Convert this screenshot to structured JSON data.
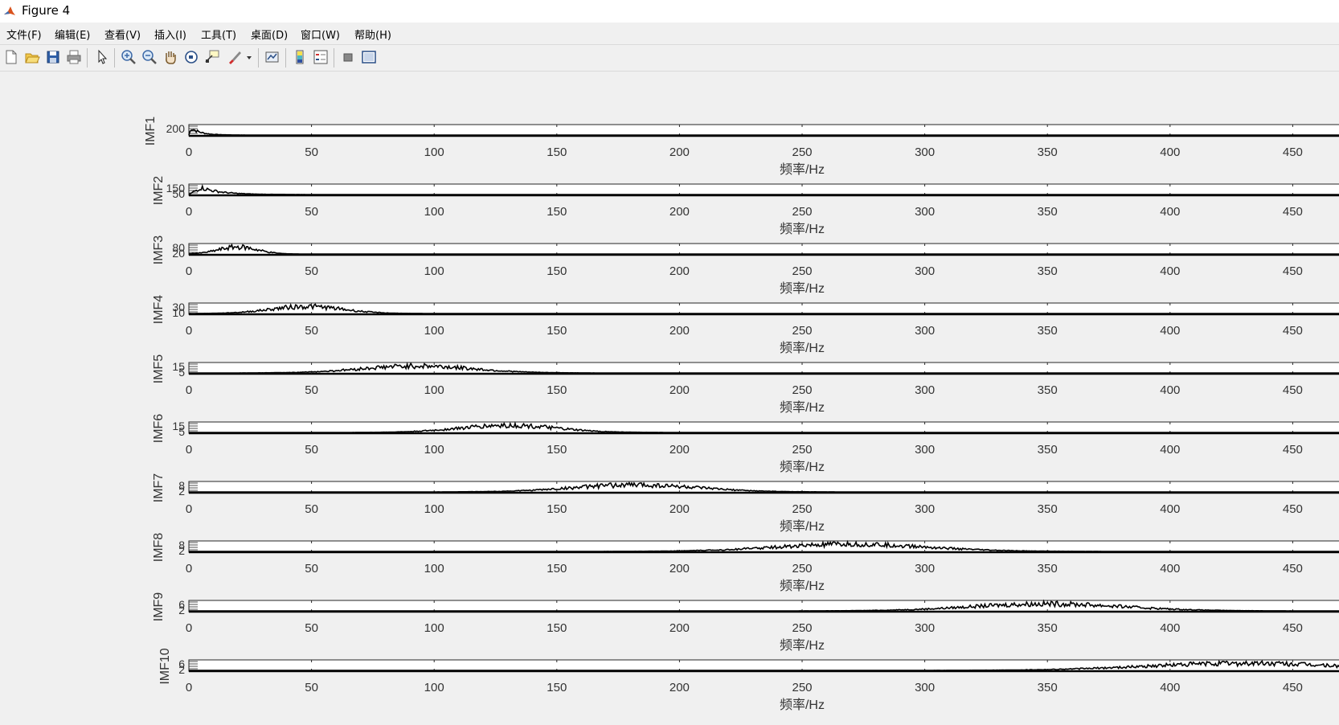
{
  "window": {
    "title": "Figure 4"
  },
  "menu": {
    "items": [
      "文件(F)",
      "编辑(E)",
      "查看(V)",
      "插入(I)",
      "工具(T)",
      "桌面(D)",
      "窗口(W)",
      "帮助(H)"
    ]
  },
  "toolbar": {
    "buttons": [
      "new-figure",
      "open-file",
      "save",
      "print",
      "select-pointer",
      "zoom-in",
      "zoom-out",
      "pan",
      "rotate-3d",
      "data-cursor",
      "brush",
      "link-plot",
      "insert-colorbar",
      "insert-legend",
      "hide-plot-tools",
      "show-plot-tools"
    ]
  },
  "chart_data": {
    "type": "line",
    "xlim": [
      0,
      500
    ],
    "x_ticks": [
      0,
      50,
      100,
      150,
      200,
      250,
      300,
      350,
      400,
      450
    ],
    "xlabel": "频率/Hz",
    "line_color": "#000000",
    "panels": [
      {
        "ylabel": "IMF1",
        "yticks": [
          "200"
        ],
        "peak_hz": 1,
        "width_hz": 4,
        "envelope": "decay"
      },
      {
        "ylabel": "IMF2",
        "yticks": [
          "150",
          "50"
        ],
        "peak_hz": 5,
        "width_hz": 8,
        "envelope": "decay"
      },
      {
        "ylabel": "IMF3",
        "yticks": [
          "80",
          "20"
        ],
        "peak_hz": 20,
        "width_hz": 14,
        "envelope": "bump"
      },
      {
        "ylabel": "IMF4",
        "yticks": [
          "30",
          "10"
        ],
        "peak_hz": 48,
        "width_hz": 26,
        "envelope": "bump"
      },
      {
        "ylabel": "IMF5",
        "yticks": [
          "15",
          "5"
        ],
        "peak_hz": 93,
        "width_hz": 40,
        "envelope": "bump"
      },
      {
        "ylabel": "IMF6",
        "yticks": [
          "15",
          "5"
        ],
        "peak_hz": 130,
        "width_hz": 35,
        "envelope": "bump"
      },
      {
        "ylabel": "IMF7",
        "yticks": [
          "8",
          "2"
        ],
        "peak_hz": 182,
        "width_hz": 45,
        "envelope": "bump"
      },
      {
        "ylabel": "IMF8",
        "yticks": [
          "8",
          "2"
        ],
        "peak_hz": 270,
        "width_hz": 55,
        "envelope": "bump"
      },
      {
        "ylabel": "IMF9",
        "yticks": [
          "6",
          "2"
        ],
        "peak_hz": 350,
        "width_hz": 55,
        "envelope": "bump"
      },
      {
        "ylabel": "IMF10",
        "yticks": [
          "6",
          "2"
        ],
        "peak_hz": 430,
        "width_hz": 70,
        "envelope": "bump"
      }
    ]
  }
}
